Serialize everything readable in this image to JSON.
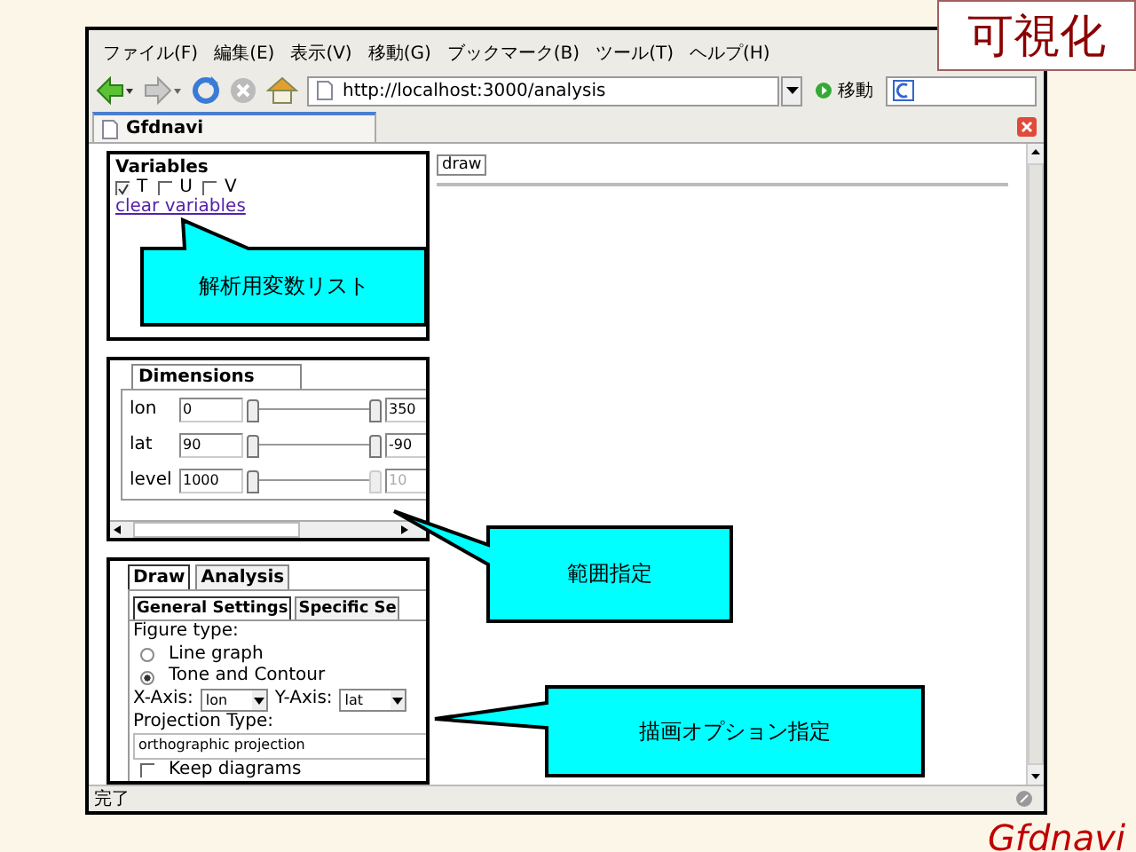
{
  "slide_title": "可視化",
  "logo": "Gfdnavi",
  "browser": {
    "menu": [
      "ファイル(F)",
      "編集(E)",
      "表示(V)",
      "移動(G)",
      "ブックマーク(B)",
      "ツール(T)",
      "ヘルプ(H)"
    ],
    "url": "http://localhost:3000/analysis",
    "go_label": "移動",
    "tab_title": "Gfdnavi",
    "status": "完了"
  },
  "variables": {
    "title": "Variables",
    "items": [
      {
        "label": "T",
        "checked": true
      },
      {
        "label": "U",
        "checked": false
      },
      {
        "label": "V",
        "checked": false
      }
    ],
    "link": "clear variables"
  },
  "draw_button": "draw",
  "dimensions": {
    "tab": "Dimensions",
    "rows": [
      {
        "name": "lon",
        "from": "0",
        "to": "350",
        "disabled": false
      },
      {
        "name": "lat",
        "from": "90",
        "to": "-90",
        "disabled": false
      },
      {
        "name": "level",
        "from": "1000",
        "to": "10",
        "disabled": true
      }
    ]
  },
  "draw_panel": {
    "tabs": [
      {
        "label": "Draw",
        "selected": true
      },
      {
        "label": "Analysis",
        "selected": false
      }
    ],
    "subtabs": [
      {
        "label": "General Settings",
        "selected": true
      },
      {
        "label": "Specific Se",
        "selected": false
      }
    ],
    "figure_type_label": "Figure type:",
    "figure_types": [
      {
        "label": "Line graph",
        "selected": false
      },
      {
        "label": "Tone and Contour",
        "selected": true
      }
    ],
    "x_axis": {
      "label": "X-Axis:",
      "value": "lon"
    },
    "y_axis": {
      "label": "Y-Axis:",
      "value": "lat"
    },
    "projection_label": "Projection Type:",
    "projection_value": "orthographic projection",
    "keep_diagrams": {
      "label": "Keep diagrams",
      "checked": false
    }
  },
  "callouts": [
    {
      "text": "解析用変数リスト"
    },
    {
      "text": "範囲指定"
    },
    {
      "text": "描画オプション指定"
    }
  ]
}
